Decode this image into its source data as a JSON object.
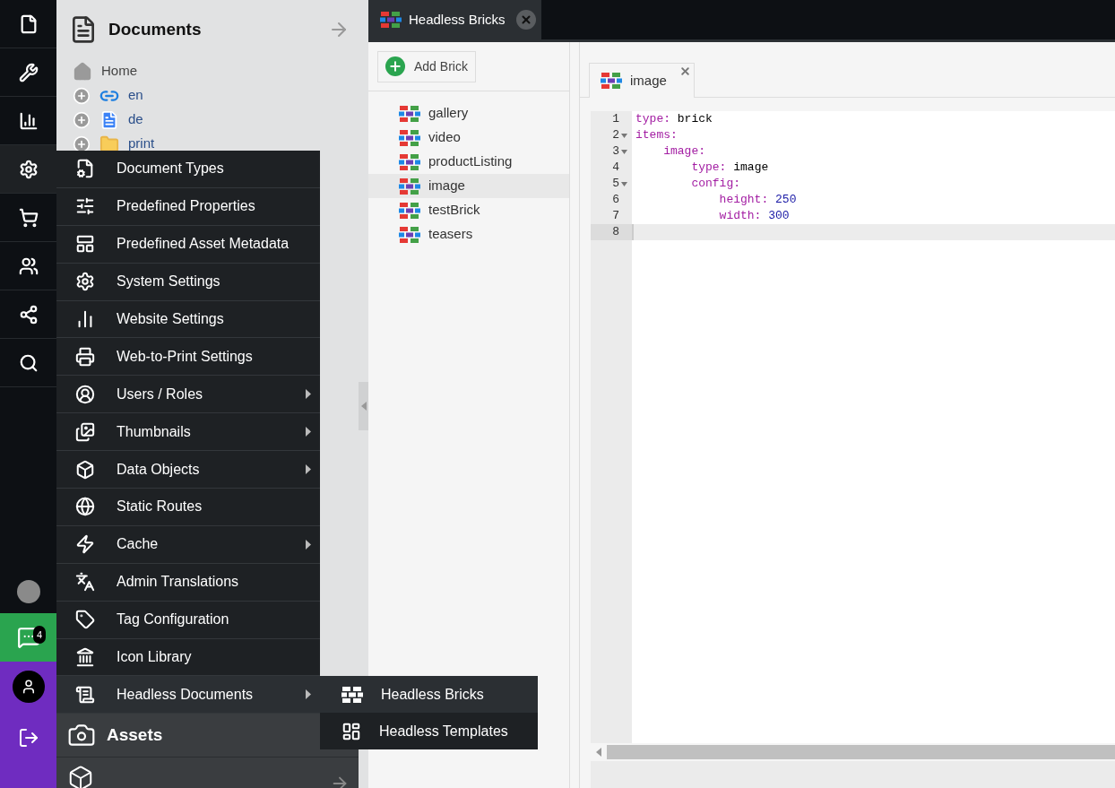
{
  "rail": {
    "items": [
      {
        "selected": false
      },
      {
        "selected": false
      },
      {
        "selected": false
      },
      {
        "selected": true
      },
      {
        "selected": false
      },
      {
        "selected": false
      },
      {
        "selected": false
      },
      {
        "selected": false
      }
    ],
    "notifications_badge": "4"
  },
  "documents_panel": {
    "title": "Documents",
    "tree": [
      {
        "label": "Home",
        "kind": "home"
      },
      {
        "label": "en",
        "kind": "link"
      },
      {
        "label": "de",
        "kind": "page"
      },
      {
        "label": "print",
        "kind": "folder"
      }
    ],
    "sections": [
      {
        "label": "Assets"
      }
    ]
  },
  "settings_menu": {
    "items": [
      {
        "label": "Document Types",
        "submenu": false,
        "selected": false
      },
      {
        "label": "Predefined Properties",
        "submenu": false,
        "selected": false
      },
      {
        "label": "Predefined Asset Metadata",
        "submenu": false,
        "selected": false
      },
      {
        "label": "System Settings",
        "submenu": false,
        "selected": false
      },
      {
        "label": "Website Settings",
        "submenu": false,
        "selected": false
      },
      {
        "label": "Web-to-Print Settings",
        "submenu": false,
        "selected": false
      },
      {
        "label": "Users / Roles",
        "submenu": true,
        "selected": false
      },
      {
        "label": "Thumbnails",
        "submenu": true,
        "selected": false
      },
      {
        "label": "Data Objects",
        "submenu": true,
        "selected": false
      },
      {
        "label": "Static Routes",
        "submenu": false,
        "selected": false
      },
      {
        "label": "Cache",
        "submenu": true,
        "selected": false
      },
      {
        "label": "Admin Translations",
        "submenu": false,
        "selected": false
      },
      {
        "label": "Tag Configuration",
        "submenu": false,
        "selected": false
      },
      {
        "label": "Icon Library",
        "submenu": false,
        "selected": false
      },
      {
        "label": "Headless Documents",
        "submenu": true,
        "selected": true
      }
    ]
  },
  "submenu": {
    "items": [
      {
        "label": "Headless Bricks",
        "selected": true
      },
      {
        "label": "Headless Templates",
        "selected": false
      }
    ]
  },
  "tabs": [
    {
      "label": "Headless Bricks",
      "selected": true
    }
  ],
  "bricks_panel": {
    "add_button": "Add Brick",
    "items": [
      {
        "label": "gallery",
        "selected": false
      },
      {
        "label": "video",
        "selected": false
      },
      {
        "label": "productListing",
        "selected": false
      },
      {
        "label": "image",
        "selected": true
      },
      {
        "label": "testBrick",
        "selected": false
      },
      {
        "label": "teasers",
        "selected": false
      }
    ]
  },
  "editor": {
    "tab": "image",
    "lines": [
      {
        "number": "1",
        "foldable": false,
        "active": false,
        "tokens": [
          {
            "kind": "key",
            "text": "type:"
          },
          {
            "kind": "value",
            "text": " brick"
          }
        ]
      },
      {
        "number": "2",
        "foldable": true,
        "active": false,
        "tokens": [
          {
            "kind": "key",
            "text": "items:"
          }
        ]
      },
      {
        "number": "3",
        "foldable": true,
        "active": false,
        "tokens": [
          {
            "kind": "key",
            "text": "    image:"
          }
        ]
      },
      {
        "number": "4",
        "foldable": false,
        "active": false,
        "tokens": [
          {
            "kind": "key",
            "text": "        type:"
          },
          {
            "kind": "value",
            "text": " image"
          }
        ]
      },
      {
        "number": "5",
        "foldable": true,
        "active": false,
        "tokens": [
          {
            "kind": "key",
            "text": "        config:"
          }
        ]
      },
      {
        "number": "6",
        "foldable": false,
        "active": false,
        "tokens": [
          {
            "kind": "key",
            "text": "            height:"
          },
          {
            "kind": "number",
            "text": " 250"
          }
        ]
      },
      {
        "number": "7",
        "foldable": false,
        "active": false,
        "tokens": [
          {
            "kind": "key",
            "text": "            width:"
          },
          {
            "kind": "number",
            "text": " 300"
          }
        ]
      },
      {
        "number": "8",
        "foldable": false,
        "active": true
      }
    ]
  }
}
